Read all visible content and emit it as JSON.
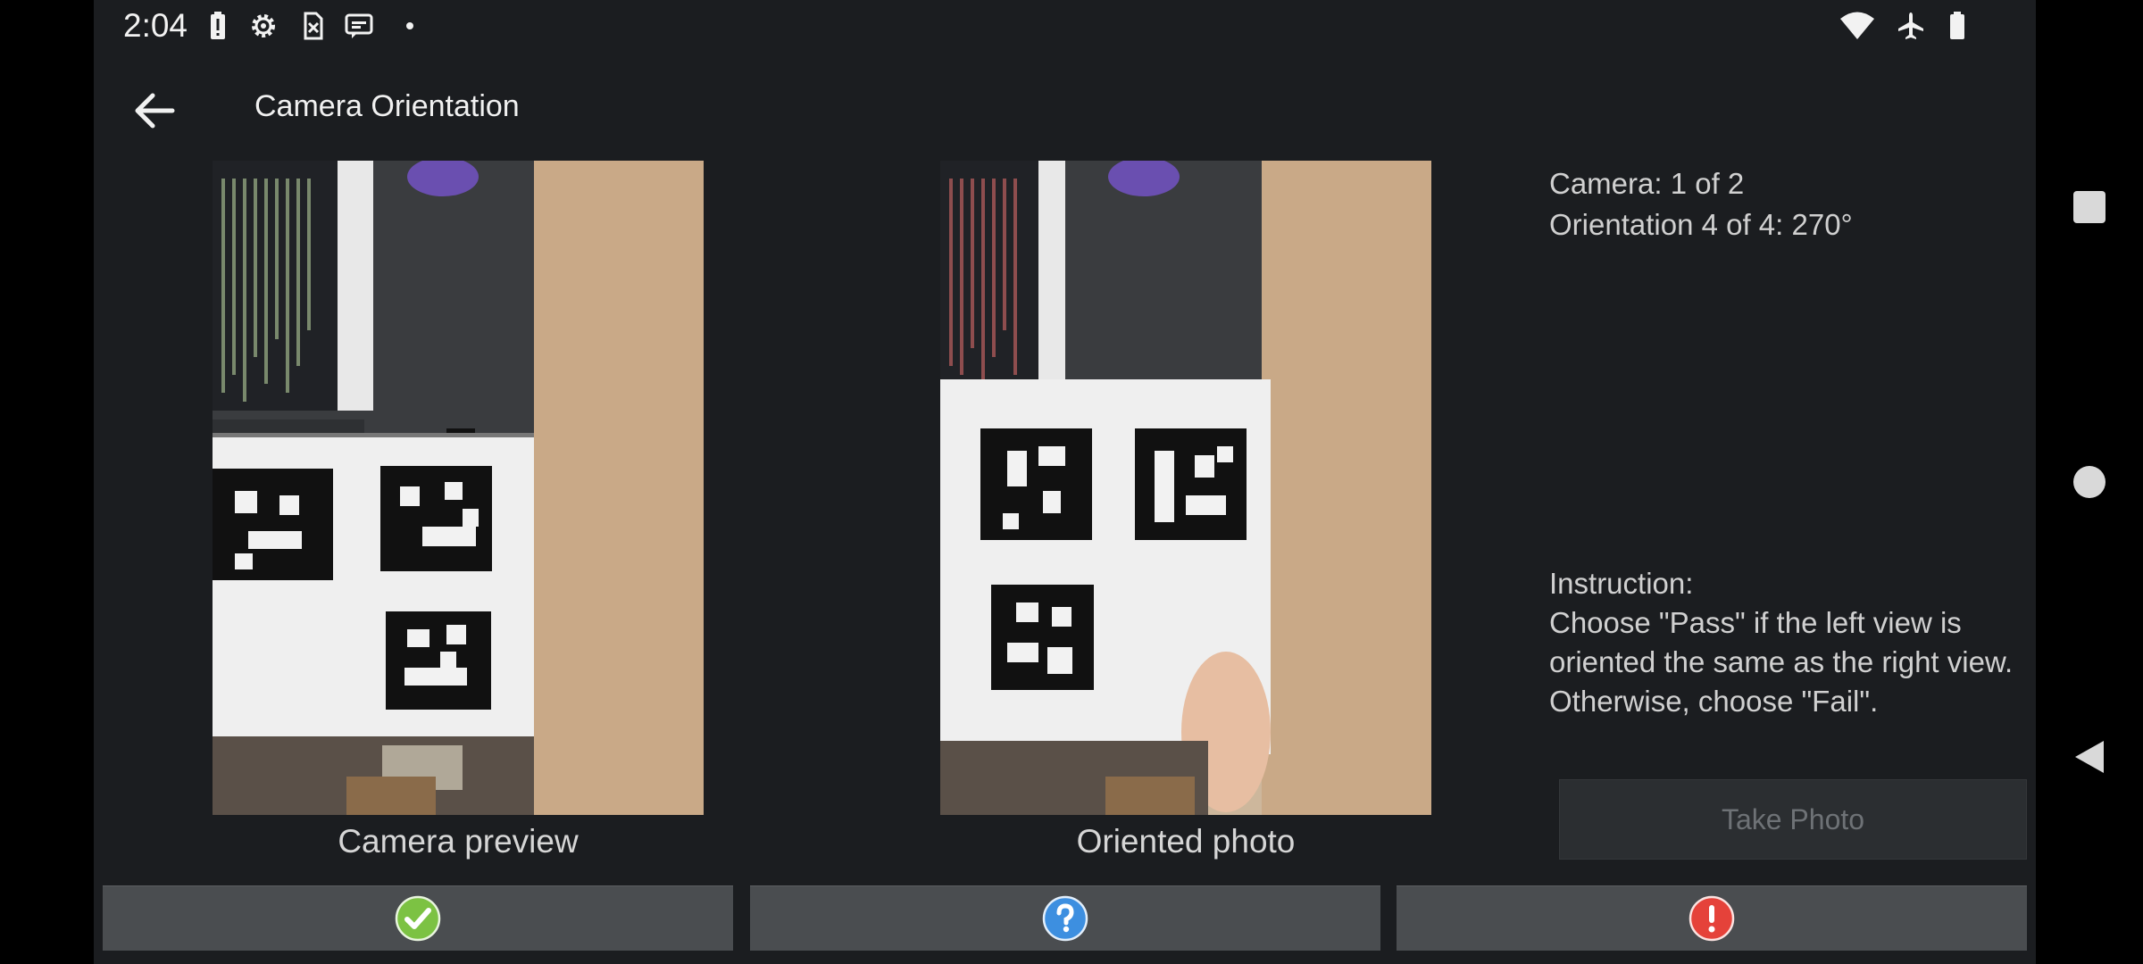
{
  "status_bar": {
    "time": "2:04",
    "left_icons": [
      "battery-alert-icon",
      "settings-gear-icon",
      "sim-card-alert-icon",
      "message-icon",
      "dot-icon"
    ],
    "right_icons": [
      "wifi-icon",
      "airplane-icon",
      "battery-icon"
    ]
  },
  "app_bar": {
    "title": "Camera Orientation",
    "back_icon": "arrow-left-icon"
  },
  "left_view": {
    "caption": "Camera preview"
  },
  "right_view": {
    "caption": "Oriented photo"
  },
  "info": {
    "camera": "Camera: 1 of 2",
    "orientation": "Orientation 4 of 4: 270°",
    "instruction_heading": "Instruction:",
    "instruction_text": "Choose \"Pass\" if the left view is oriented the same as the right view. Otherwise, choose \"Fail\"."
  },
  "take_photo_label": "Take Photo",
  "bottom_buttons": [
    {
      "name": "pass",
      "icon": "green-check-circle-icon",
      "color": "#7cc243"
    },
    {
      "name": "info",
      "icon": "blue-question-circle-icon",
      "color": "#3d8fe0"
    },
    {
      "name": "fail",
      "icon": "red-exclamation-circle-icon",
      "color": "#e5423a"
    }
  ],
  "nav_bar": [
    "recents-square-icon",
    "home-circle-icon",
    "back-triangle-icon"
  ]
}
